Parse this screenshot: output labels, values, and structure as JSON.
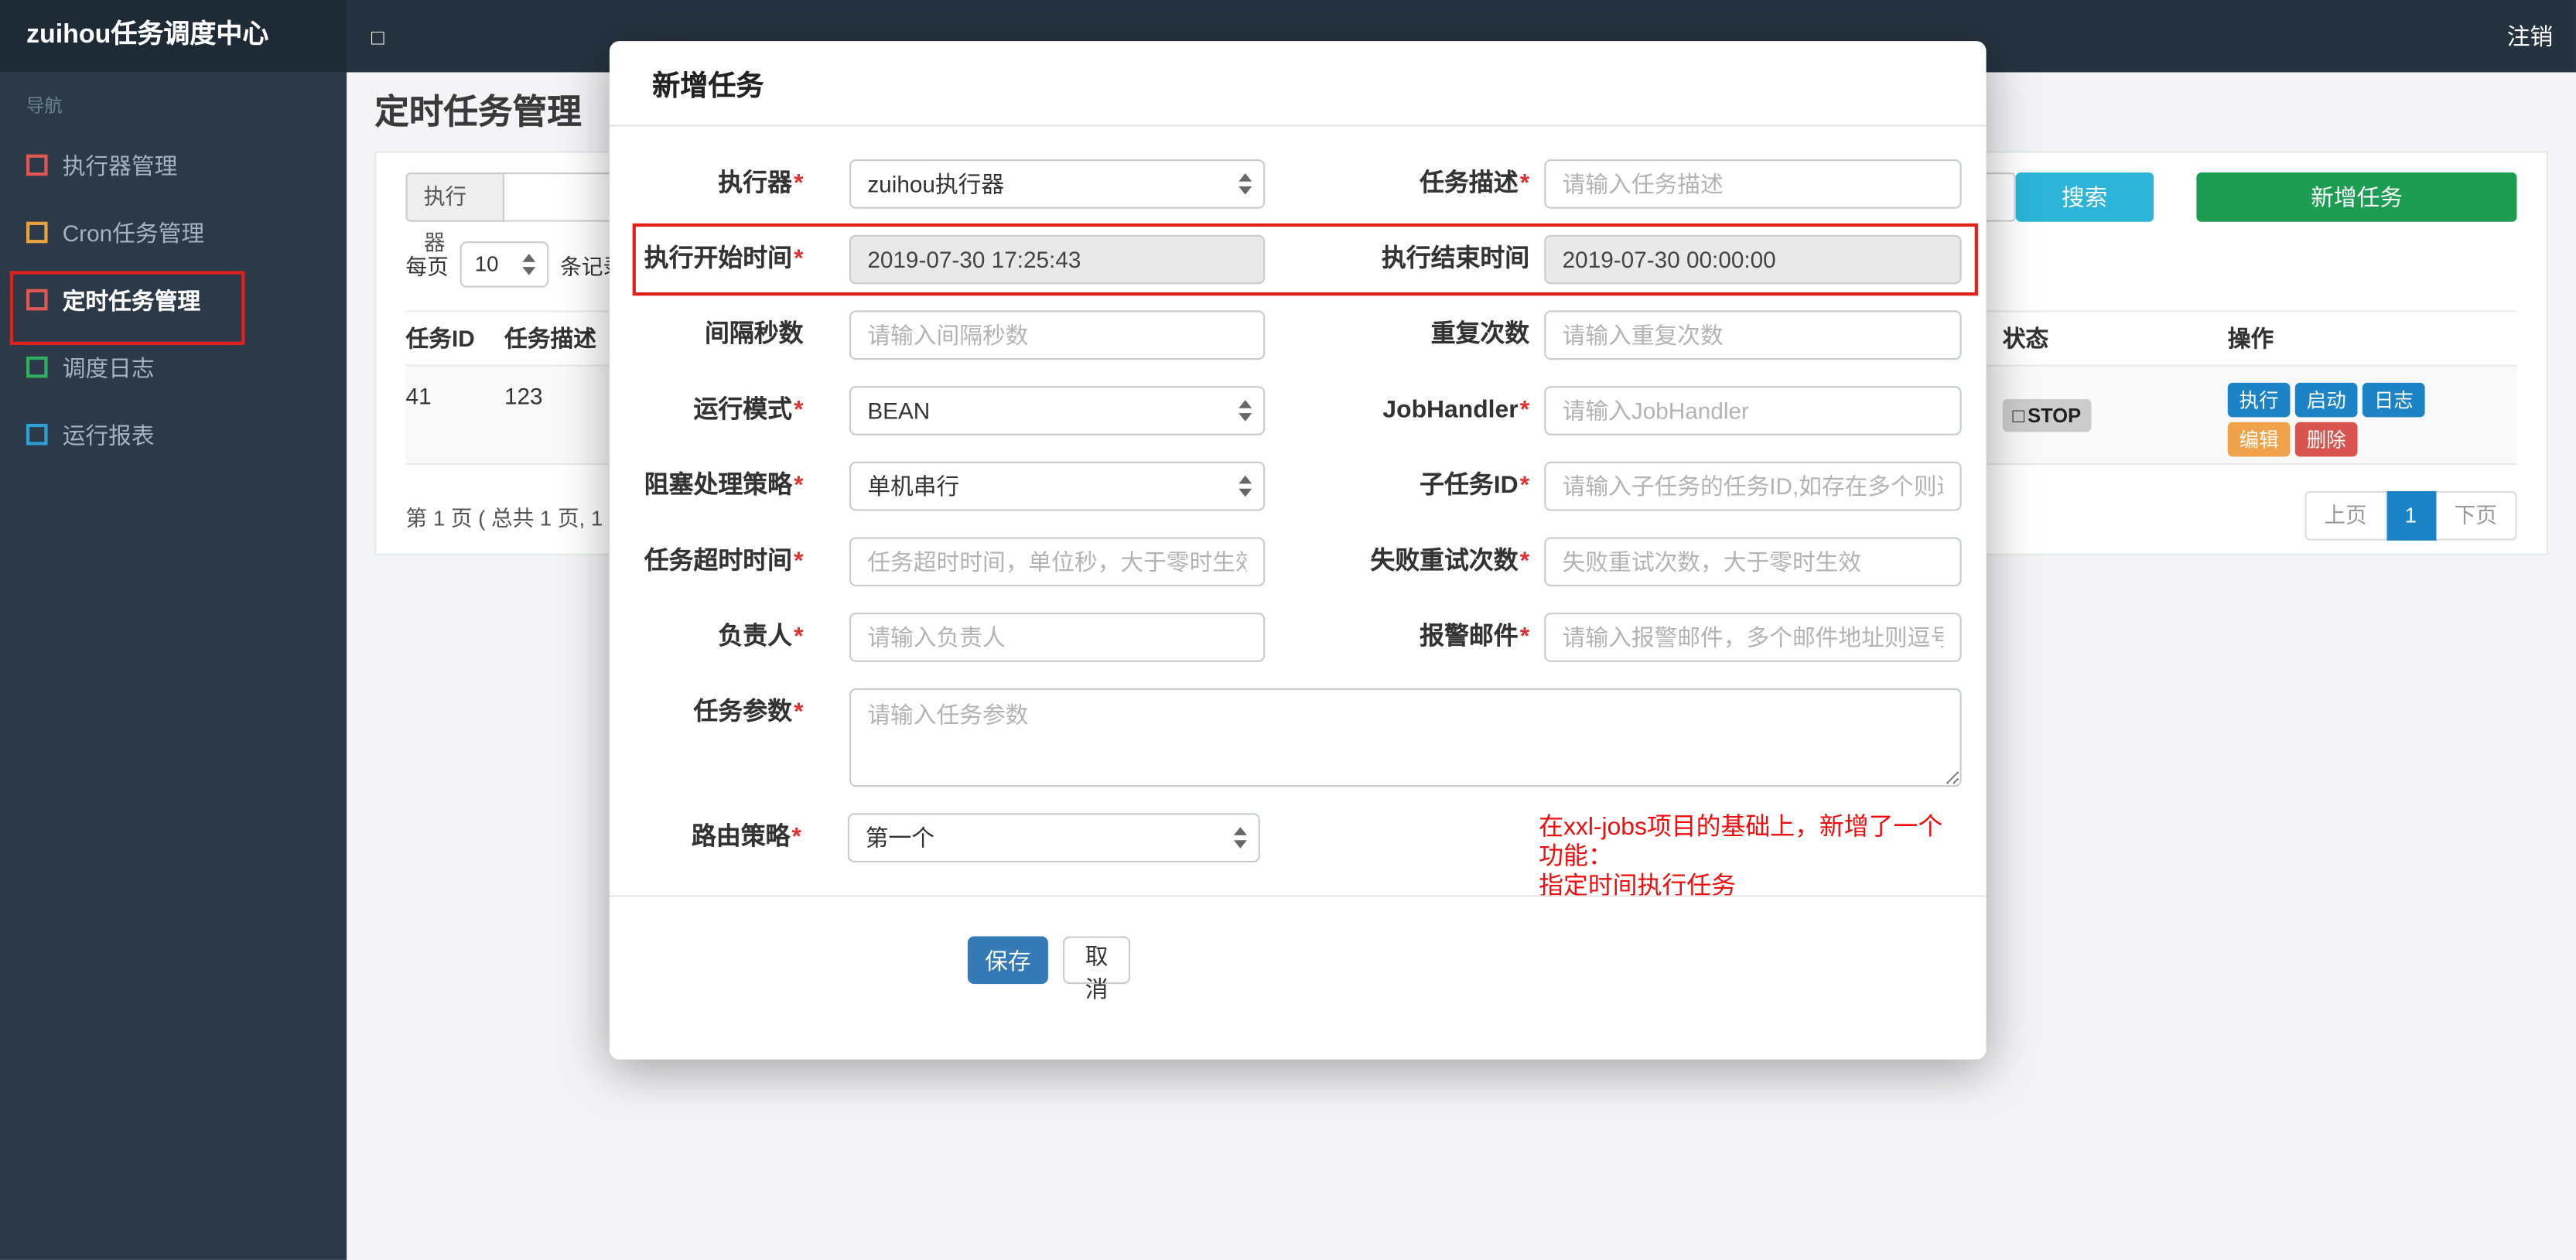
{
  "colors": {
    "navbar_bg": "#253340",
    "brand_bg": "#1e2a35",
    "sidebar_bg": "#2b3948",
    "info_btn": "#2cb5d8",
    "success_btn": "#1c9d52",
    "primary_btn": "#1c84c6",
    "save_btn": "#337ab7",
    "warning_btn": "#f0a24a",
    "danger_btn": "#d9534f",
    "annotation_red": "#e0211a",
    "hint_red": "#f00c0c",
    "status_badge_bg": "#cccccc"
  },
  "topbar": {
    "brand": "zuihou任务调度中心",
    "collapse_icon": "□",
    "logout": "注销"
  },
  "sidebar": {
    "nav_label": "导航",
    "items": [
      {
        "label": "执行器管理",
        "icon_color": "#e0574f"
      },
      {
        "label": "Cron任务管理",
        "icon_color": "#e8a33d"
      },
      {
        "label": "定时任务管理",
        "icon_color": "#e0574f"
      },
      {
        "label": "调度日志",
        "icon_color": "#2fae60"
      },
      {
        "label": "运行报表",
        "icon_color": "#2e9fd0"
      }
    ]
  },
  "page": {
    "title": "定时任务管理",
    "toolbar": {
      "executor_label": "执行器",
      "search_button": "搜索",
      "add_button": "新增任务"
    },
    "per_page": {
      "prefix": "每页",
      "value": "10",
      "suffix": "条记录"
    },
    "table": {
      "headers": [
        "任务ID",
        "任务描述",
        "状态",
        "操作"
      ],
      "row": {
        "task_id": "41",
        "task_desc": "123",
        "status_icon": "□",
        "status": "STOP",
        "actions": [
          "执行",
          "启动",
          "日志",
          "编辑",
          "删除"
        ]
      }
    },
    "page_info": "第 1 页 ( 总共 1 页, 1",
    "pagination": {
      "prev": "上页",
      "current": "1",
      "next": "下页"
    }
  },
  "modal": {
    "title": "新增任务",
    "required_marker": "*",
    "rows": [
      {
        "left": {
          "label": "执行器",
          "value": "zuihou执行器"
        },
        "right": {
          "label": "任务描述",
          "placeholder": "请输入任务描述"
        }
      },
      {
        "left": {
          "label": "执行开始时间",
          "value": "2019-07-30 17:25:43"
        },
        "right": {
          "label": "执行结束时间",
          "value": "2019-07-30 00:00:00"
        }
      },
      {
        "left": {
          "label": "间隔秒数",
          "placeholder": "请输入间隔秒数"
        },
        "right": {
          "label": "重复次数",
          "placeholder": "请输入重复次数"
        }
      },
      {
        "left": {
          "label": "运行模式",
          "value": "BEAN"
        },
        "right": {
          "label": "JobHandler",
          "placeholder": "请输入JobHandler"
        }
      },
      {
        "left": {
          "label": "阻塞处理策略",
          "value": "单机串行"
        },
        "right": {
          "label": "子任务ID",
          "placeholder": "请输入子任务的任务ID,如存在多个则逗号分隔"
        }
      },
      {
        "left": {
          "label": "任务超时时间",
          "placeholder": "任务超时时间，单位秒，大于零时生效"
        },
        "right": {
          "label": "失败重试次数",
          "placeholder": "失败重试次数，大于零时生效"
        }
      },
      {
        "left": {
          "label": "负责人",
          "placeholder": "请输入负责人"
        },
        "right": {
          "label": "报警邮件",
          "placeholder": "请输入报警邮件，多个邮件地址则逗号分隔"
        }
      }
    ],
    "params": {
      "label": "任务参数",
      "placeholder": "请输入任务参数"
    },
    "route": {
      "label": "路由策略",
      "value": "第一个"
    },
    "hint_line1": "在xxl-jobs项目的基础上，新增了一个功能：",
    "hint_line2": "指定时间执行任务",
    "save": "保存",
    "cancel": "取消"
  }
}
